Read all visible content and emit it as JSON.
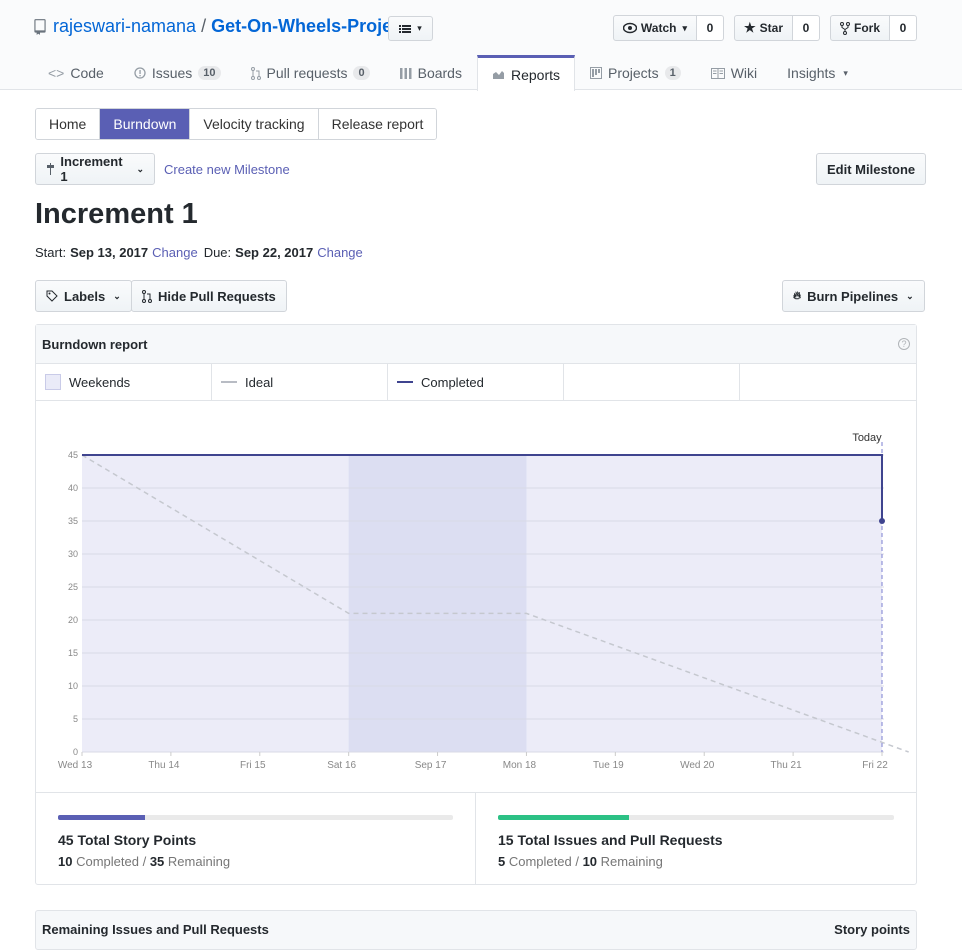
{
  "repo": {
    "owner": "rajeswari-namana",
    "separator": "/",
    "name": "Get-On-Wheels-Project"
  },
  "actions": [
    {
      "label": "Watch",
      "count": "0",
      "icon": "eye-icon"
    },
    {
      "label": "Star",
      "count": "0",
      "icon": "star-icon"
    },
    {
      "label": "Fork",
      "count": "0",
      "icon": "fork-icon"
    }
  ],
  "nav": [
    {
      "label": "Code",
      "icon": "code-icon"
    },
    {
      "label": "Issues",
      "counter": "10",
      "icon": "issue-icon"
    },
    {
      "label": "Pull requests",
      "counter": "0",
      "icon": "pull-request-icon"
    },
    {
      "label": "Boards",
      "icon": "board-icon"
    },
    {
      "label": "Reports",
      "icon": "graph-icon",
      "selected": true
    },
    {
      "label": "Projects",
      "counter": "1",
      "icon": "project-icon"
    },
    {
      "label": "Wiki",
      "icon": "book-icon"
    },
    {
      "label": "Insights",
      "icon": "caret-down-icon"
    }
  ],
  "tabs": [
    "Home",
    "Burndown",
    "Velocity tracking",
    "Release report"
  ],
  "milestone": {
    "selector": "Increment 1",
    "create_link": "Create new Milestone",
    "edit": "Edit Milestone",
    "title": "Increment 1",
    "start_label": "Start:",
    "start": "Sep 13, 2017",
    "change1": "Change",
    "due_label": "Due:",
    "due": "Sep 22, 2017",
    "change2": "Change"
  },
  "filters": {
    "labels": "Labels",
    "hide_pr": "Hide Pull Requests",
    "pipelines": "Burn Pipelines"
  },
  "report": {
    "title": "Burndown report",
    "legend": [
      "Weekends",
      "Ideal",
      "Completed"
    ]
  },
  "colors": {
    "accent": "#5a5fb4",
    "completed": "#3f448f",
    "ideal": "#c5c8cf",
    "green": "#2cc185"
  },
  "chart_data": {
    "type": "line",
    "categories": [
      "Wed 13",
      "Thu 14",
      "Fri 15",
      "Sat 16",
      "Sep 17",
      "Mon 18",
      "Tue 19",
      "Wed 20",
      "Thu 21",
      "Fri 22"
    ],
    "ylim": [
      0,
      45
    ],
    "yticks": [
      0,
      5,
      10,
      15,
      20,
      25,
      30,
      35,
      40,
      45
    ],
    "weekend_range": [
      "Sat 16",
      "Mon 18"
    ],
    "today_label": "Today",
    "series": [
      {
        "name": "Ideal",
        "x": [
          0,
          3,
          5,
          9.3
        ],
        "values": [
          45,
          21,
          21,
          0
        ]
      },
      {
        "name": "Completed",
        "x": [
          0,
          9,
          9
        ],
        "values": [
          45,
          45,
          35
        ]
      }
    ]
  },
  "stats": {
    "points": {
      "title": "45 Total Story Points",
      "completed": "10",
      "completed_label": "Completed /",
      "remaining": "35",
      "remaining_label": "Remaining",
      "progress": 0.22
    },
    "issues": {
      "title": "15 Total Issues and Pull Requests",
      "completed": "5",
      "completed_label": "Completed /",
      "remaining": "10",
      "remaining_label": "Remaining",
      "progress": 0.33
    }
  },
  "remaining": {
    "title": "Remaining Issues and Pull Requests",
    "col": "Story points"
  }
}
